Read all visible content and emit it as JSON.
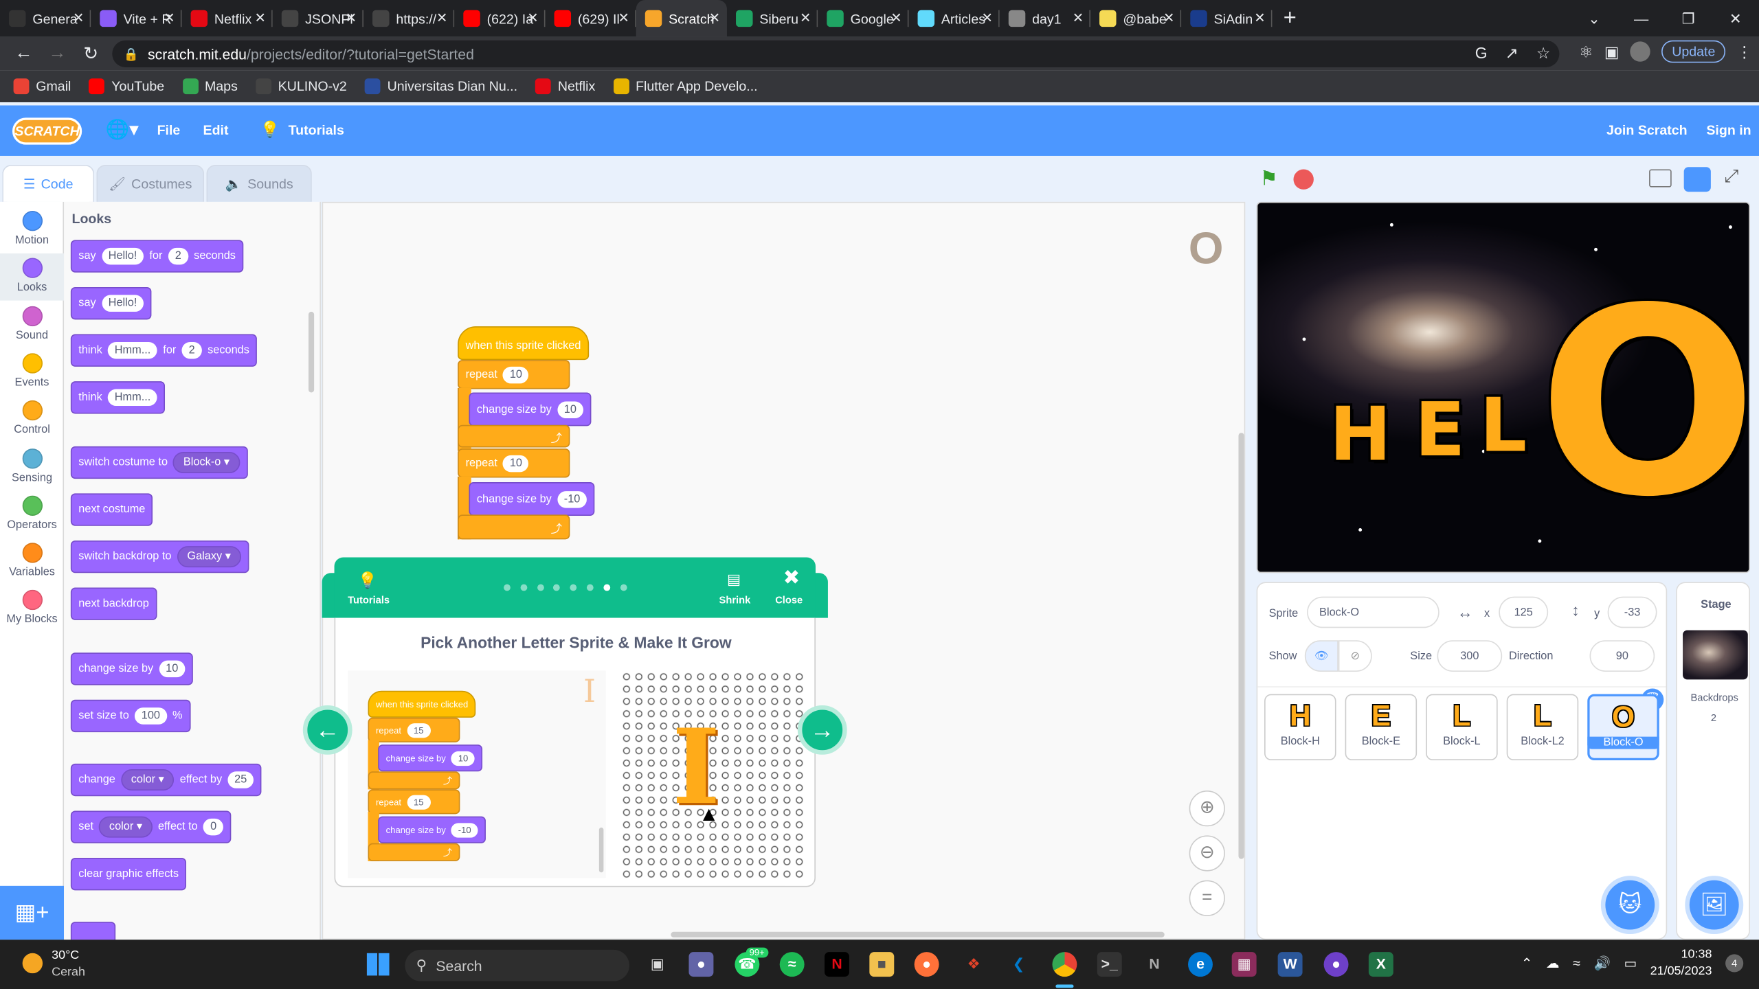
{
  "browser": {
    "tabs": [
      {
        "title": "Genera",
        "icon": "github-icon",
        "color": "#333333"
      },
      {
        "title": "Vite + R",
        "icon": "vite-icon",
        "color": "#8a5cf6"
      },
      {
        "title": "Netflix",
        "icon": "netflix-icon",
        "color": "#e50914"
      },
      {
        "title": "JSONPl",
        "icon": "jsonplaceholder-icon",
        "color": "#444444"
      },
      {
        "title": "https://",
        "icon": "page-icon",
        "color": "#444444"
      },
      {
        "title": "(622) Ia",
        "icon": "youtube-icon",
        "color": "#ff0000"
      },
      {
        "title": "(629) Il",
        "icon": "youtube-icon",
        "color": "#ff0000"
      },
      {
        "title": "Scratch",
        "icon": "scratch-icon",
        "color": "#f7a62b",
        "active": true
      },
      {
        "title": "Siberu",
        "icon": "drive-icon",
        "color": "#1fa463"
      },
      {
        "title": "Google",
        "icon": "drive-icon",
        "color": "#1fa463"
      },
      {
        "title": "Articles",
        "icon": "react-icon",
        "color": "#61dafb"
      },
      {
        "title": "day1",
        "icon": "globe-icon",
        "color": "#888888"
      },
      {
        "title": "@babe",
        "icon": "babel-icon",
        "color": "#f5da55"
      },
      {
        "title": "SiAdin",
        "icon": "siadin-icon",
        "color": "#1a3c8c"
      }
    ],
    "new_tab": "+",
    "url_host": "scratch.mit.edu",
    "url_path": "/projects/editor/?tutorial=getStarted",
    "update_label": "Update",
    "bookmarks": [
      {
        "label": "Gmail",
        "color": "#ea4335"
      },
      {
        "label": "YouTube",
        "color": "#ff0000"
      },
      {
        "label": "Maps",
        "color": "#34a853"
      },
      {
        "label": "KULINO-v2",
        "color": "#444444"
      },
      {
        "label": "Universitas Dian Nu...",
        "color": "#2b4fa0"
      },
      {
        "label": "Netflix",
        "color": "#e50914"
      },
      {
        "label": "Flutter App Develo...",
        "color": "#e8b500"
      }
    ]
  },
  "scratch": {
    "logo": "SCRATCH",
    "menu": {
      "file": "File",
      "edit": "Edit",
      "tutorials": "Tutorials",
      "join": "Join Scratch",
      "signin": "Sign in"
    },
    "tabs": {
      "code": "Code",
      "costumes": "Costumes",
      "sounds": "Sounds"
    },
    "categories": [
      {
        "label": "Motion",
        "color": "#4c97ff"
      },
      {
        "label": "Looks",
        "color": "#9966ff"
      },
      {
        "label": "Sound",
        "color": "#cf63cf"
      },
      {
        "label": "Events",
        "color": "#ffbf00"
      },
      {
        "label": "Control",
        "color": "#ffab19"
      },
      {
        "label": "Sensing",
        "color": "#5cb1d6"
      },
      {
        "label": "Operators",
        "color": "#59c059"
      },
      {
        "label": "Variables",
        "color": "#ff8c1a"
      },
      {
        "label": "My Blocks",
        "color": "#ff6680"
      }
    ],
    "palette": {
      "title": "Looks",
      "say_for": {
        "say": "say",
        "msg": "Hello!",
        "for": "for",
        "secs": "2",
        "seconds": "seconds"
      },
      "say": {
        "say": "say",
        "msg": "Hello!"
      },
      "think_for": {
        "think": "think",
        "msg": "Hmm...",
        "for": "for",
        "secs": "2",
        "seconds": "seconds"
      },
      "think": {
        "think": "think",
        "msg": "Hmm..."
      },
      "switch_costume": {
        "label": "switch costume to",
        "value": "Block-o"
      },
      "next_costume": "next costume",
      "switch_backdrop": {
        "label": "switch backdrop to",
        "value": "Galaxy"
      },
      "next_backdrop": "next backdrop",
      "change_size": {
        "label": "change size by",
        "value": "10"
      },
      "set_size": {
        "label": "set size to",
        "value": "100",
        "unit": "%"
      },
      "change_effect": {
        "label": "change",
        "effect": "color",
        "by": "effect by",
        "value": "25"
      },
      "set_effect": {
        "label": "set",
        "effect": "color",
        "to": "effect to",
        "value": "0"
      },
      "clear_effects": "clear graphic effects"
    },
    "script": {
      "hat": "when this sprite clicked",
      "repeat_label": "repeat",
      "repeat1": "10",
      "change1_label": "change size by",
      "change1_value": "10",
      "repeat2": "10",
      "change2_label": "change size by",
      "change2_value": "-10"
    },
    "tutorial": {
      "tutorials_label": "Tutorials",
      "shrink_label": "Shrink",
      "close_label": "Close",
      "title": "Pick Another Letter Sprite & Make It Grow",
      "page_count": 8,
      "current_page": 7,
      "img": {
        "hat": "when this sprite clicked",
        "repeat_label": "repeat",
        "repeat1": "15",
        "change_label": "change size by",
        "change1": "10",
        "repeat2": "15",
        "change2": "-10"
      }
    },
    "stage": {
      "letters": [
        "H",
        "E",
        "L",
        "O"
      ]
    },
    "sprite_info": {
      "sprite_label": "Sprite",
      "sprite_name": "Block-O",
      "x_label": "x",
      "x": "125",
      "y_label": "y",
      "y": "-33",
      "show_label": "Show",
      "size_label": "Size",
      "size": "300",
      "direction_label": "Direction",
      "direction": "90"
    },
    "sprites": [
      {
        "glyph": "H",
        "name": "Block-H"
      },
      {
        "glyph": "E",
        "name": "Block-E"
      },
      {
        "glyph": "L",
        "name": "Block-L"
      },
      {
        "glyph": "L",
        "name": "Block-L2"
      },
      {
        "glyph": "O",
        "name": "Block-O",
        "selected": true
      }
    ],
    "stage_panel": {
      "title": "Stage",
      "backdrops_label": "Backdrops",
      "backdrops_count": "2"
    }
  },
  "taskbar": {
    "weather_temp": "30°C",
    "weather_desc": "Cerah",
    "search_label": "Search",
    "whatsapp_badge": "99+",
    "time": "10:38",
    "date": "21/05/2023",
    "notif_count": "4"
  }
}
